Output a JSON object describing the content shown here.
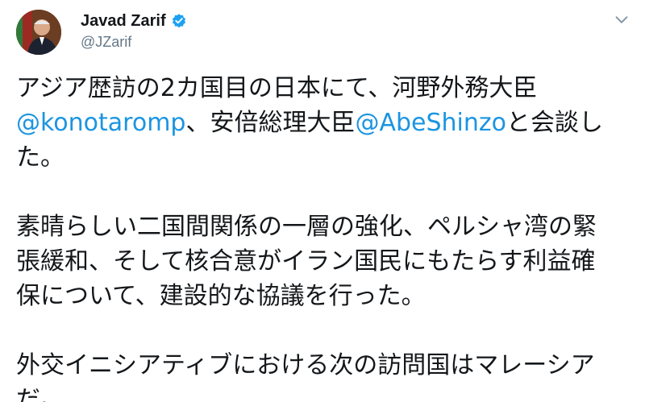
{
  "author": {
    "name": "Javad Zarif",
    "handle": "@JZarif",
    "verified_icon": "verified-badge-icon",
    "menu_icon": "chevron-down-icon",
    "accent_color": "#1b95e0"
  },
  "tweet": {
    "p1_a": "アジア歴訪の2カ国目の日本にて、河野外務大臣",
    "p1_mention1": "@konotaromp",
    "p1_b": "、安倍総理大臣",
    "p1_mention2": "@AbeShinzo",
    "p1_c": "と会談し",
    "p1_d": "た。",
    "p2_line1": "素晴らしい二国間関係の一層の強化、ペルシャ湾の緊",
    "p2_line2": "張緩和、そして核合意がイラン国民にもたらす利益確",
    "p2_line3": "保について、建設的な協議を行った。",
    "p3_line1": "外交イニシアティブにおける次の訪問国はマレーシア",
    "p3_line2": "だ。"
  }
}
